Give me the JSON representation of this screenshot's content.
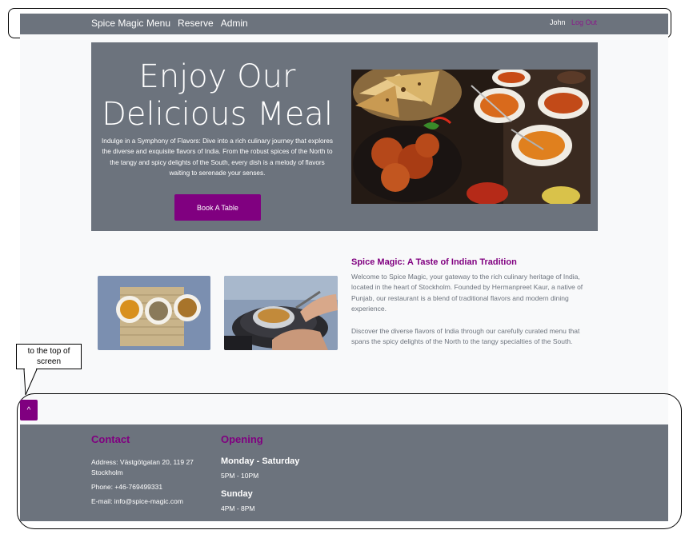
{
  "navbar": {
    "brand": "Spice Magic",
    "links": [
      "Menu",
      "Reserve",
      "Admin"
    ],
    "user": "John",
    "logout": "Log Out"
  },
  "hero": {
    "title_line1": "Enjoy Our",
    "title_line2": "Delicious Meal",
    "text": "Indulge in a Symphony of Flavors: Dive into a rich culinary journey that explores the diverse and exquisite flavors of India. From the robust spices of the North to the tangy and spicy delights of the South, every dish is a melody of flavors waiting to serenade your senses.",
    "button": "Book A Table"
  },
  "about": {
    "title": "Spice Magic: A Taste of Indian Tradition",
    "p1": "Welcome to Spice Magic, your gateway to the rich culinary heritage of India, located in the heart of Stockholm. Founded by Hermanpreet Kaur, a native of Punjab, our restaurant is a blend of traditional flavors and modern dining experience.",
    "p2": "Discover the diverse flavors of India through our carefully curated menu that spans the spicy delights of the North to the tangy specialties of the South."
  },
  "annotation": {
    "callout": "to the top of screen"
  },
  "scroll_top": {
    "label": "^"
  },
  "footer": {
    "contact_title": "Contact",
    "address": "Address: Västgötgatan 20, 119 27 Stockholm",
    "phone": "Phone: +46-769499331",
    "email": "E-mail: info@spice-magic.com",
    "opening_title": "Opening",
    "weekday_label": "Monday - Saturday",
    "weekday_hours": "5PM - 10PM",
    "sunday_label": "Sunday",
    "sunday_hours": "4PM - 8PM"
  },
  "colors": {
    "accent": "#800080",
    "navbar_bg": "#6c737d",
    "page_bg": "#f8f9fa"
  }
}
